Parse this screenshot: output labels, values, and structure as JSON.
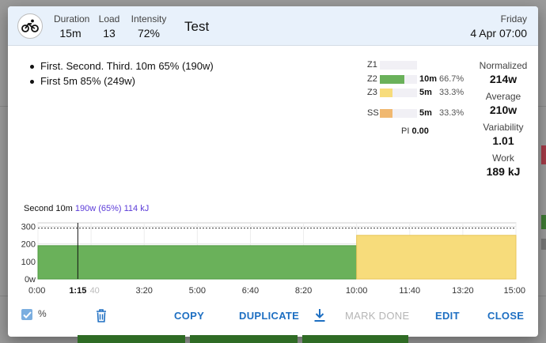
{
  "header": {
    "duration": {
      "label": "Duration",
      "value": "15m"
    },
    "load": {
      "label": "Load",
      "value": "13"
    },
    "intensity": {
      "label": "Intensity",
      "value": "72%"
    },
    "title": "Test",
    "day": "Friday",
    "date": "4 Apr 07:00",
    "sport_icon": "bicycle-icon"
  },
  "steps": [
    "First. Second. Third. 10m 65% (190w)",
    "First 5m 85% (249w)"
  ],
  "zones": [
    {
      "label": "Z1",
      "time": "",
      "pct": "",
      "fraction": 0,
      "color": "#f1f0f5"
    },
    {
      "label": "Z2",
      "time": "10m",
      "pct": "66.7%",
      "fraction": 0.667,
      "color": "#6ab15a"
    },
    {
      "label": "Z3",
      "time": "5m",
      "pct": "33.3%",
      "fraction": 0.333,
      "color": "#f7dc7b"
    },
    {
      "label": "SS",
      "time": "5m",
      "pct": "33.3%",
      "fraction": 0.333,
      "color": "#f0b870"
    }
  ],
  "pi": {
    "label": "PI",
    "value": "0.00"
  },
  "stats": [
    {
      "label": "Normalized",
      "value": "214w"
    },
    {
      "label": "Average",
      "value": "210w"
    },
    {
      "label": "Variability",
      "value": "1.01"
    },
    {
      "label": "Work",
      "value": "189 kJ"
    }
  ],
  "chart_caption": {
    "step": "Second",
    "duration": "10m",
    "detail": "190w (65%) 114 kJ"
  },
  "chart_data": {
    "type": "area",
    "x_unit": "seconds",
    "xlim": [
      0,
      900
    ],
    "ylim": [
      0,
      320
    ],
    "y_ticks": [
      "0w",
      "100",
      "200",
      "300"
    ],
    "y_tick_values": [
      0,
      100,
      200,
      300
    ],
    "x_ticks": [
      "0:00",
      "1:40",
      "3:20",
      "5:00",
      "6:40",
      "8:20",
      "10:00",
      "11:40",
      "13:20",
      "15:00"
    ],
    "x_tick_values": [
      0,
      100,
      200,
      300,
      400,
      500,
      600,
      700,
      800,
      900
    ],
    "cursor": {
      "x": 75,
      "label": "1:15"
    },
    "ftp_line": 290,
    "segments": [
      {
        "start": 0,
        "end": 600,
        "watts": 190,
        "color": "#6ab15a"
      },
      {
        "start": 600,
        "end": 900,
        "watts": 249,
        "color": "#f7dc7b"
      }
    ]
  },
  "footer": {
    "percent_label": "%",
    "percent_checked": true,
    "copy": "COPY",
    "duplicate": "DUPLICATE",
    "mark_done": "MARK DONE",
    "edit": "EDIT",
    "close": "CLOSE"
  },
  "colors": {
    "accent": "#1e6fc2",
    "header_bg": "#e8f1fb",
    "caption_accent": "#5b3bd8"
  }
}
